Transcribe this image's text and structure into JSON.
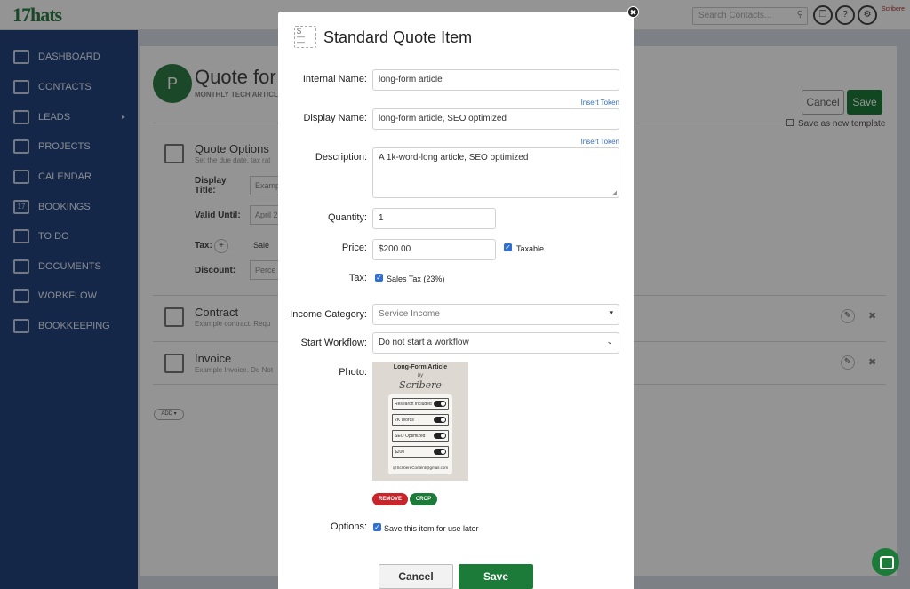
{
  "app": {
    "logo": "17hats"
  },
  "topbar": {
    "search_placeholder": "Search Contacts...",
    "avatar_text": "Scribere"
  },
  "sidebar": {
    "items": [
      {
        "label": "DASHBOARD",
        "icon": "dashboard-icon"
      },
      {
        "label": "CONTACTS",
        "icon": "contacts-icon"
      },
      {
        "label": "LEADS",
        "icon": "leads-icon"
      },
      {
        "label": "PROJECTS",
        "icon": "projects-icon"
      },
      {
        "label": "CALENDAR",
        "icon": "calendar-icon"
      },
      {
        "label": "BOOKINGS",
        "icon": "bookings-icon"
      },
      {
        "label": "TO DO",
        "icon": "todo-icon"
      },
      {
        "label": "DOCUMENTS",
        "icon": "documents-icon"
      },
      {
        "label": "WORKFLOW",
        "icon": "workflow-icon"
      },
      {
        "label": "BOOKKEEPING",
        "icon": "bookkeeping-icon"
      }
    ]
  },
  "background": {
    "avatar_letter": "P",
    "title": "Quote for",
    "subtitle": "MONTHLY TECH ARTICL",
    "cancel": "Cancel",
    "save": "Save",
    "save_template": "Save as new template",
    "options_title": "Quote Options",
    "options_sub": "Set the due date, tax rat",
    "display_title_label": "Display Title:",
    "display_title_value": "Examp",
    "valid_until_label": "Valid Until:",
    "valid_until_value": "April 2",
    "tax_label": "Tax:",
    "tax_value": "Sale",
    "discount_label": "Discount:",
    "discount_value": "Perce",
    "contract_title": "Contract",
    "contract_sub": "Example contract. Requ",
    "invoice_title": "Invoice",
    "invoice_sub": "Example Invoice. Do Not",
    "add": "ADD"
  },
  "modal": {
    "title": "Standard Quote Item",
    "icon_text": "$",
    "internal_name_label": "Internal Name:",
    "internal_name_value": "long-form article",
    "insert_token": "Insert Token",
    "display_name_label": "Display Name:",
    "display_name_value": "long-form article, SEO optimized",
    "description_label": "Description:",
    "description_value": "A 1k-word-long article, SEO optimized",
    "quantity_label": "Quantity:",
    "quantity_value": "1",
    "price_label": "Price:",
    "price_value": "$200.00",
    "taxable_label": "Taxable",
    "tax_label": "Tax:",
    "sales_tax_label": "Sales Tax (23%)",
    "income_category_label": "Income Category:",
    "income_category_value": "Service Income",
    "start_workflow_label": "Start Workflow:",
    "start_workflow_value": "Do not start a workflow",
    "photo_label": "Photo:",
    "photo": {
      "title": "Long-Form Article",
      "by": "by",
      "brand": "Scribere",
      "rows": [
        "Research Included",
        "2K Words",
        "SEO Optimized",
        "$200"
      ],
      "email": "@ScribereContent@gmail.com"
    },
    "remove": "REMOVE",
    "crop": "CROP",
    "options_label": "Options:",
    "save_item_label": "Save this item for use later",
    "cancel": "Cancel",
    "save": "Save"
  },
  "colors": {
    "brand_green": "#1d7b3a",
    "sidebar_blue": "#24447e",
    "remove_red": "#c9242c",
    "link_blue": "#3a6fb0"
  }
}
